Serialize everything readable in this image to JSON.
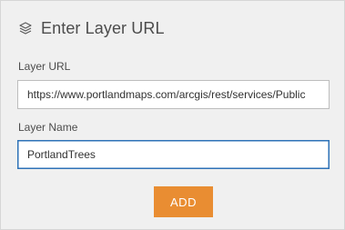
{
  "header": {
    "title": "Enter Layer URL",
    "icon": "layers-icon"
  },
  "form": {
    "url_label": "Layer URL",
    "url_value": "https://www.portlandmaps.com/arcgis/rest/services/Public",
    "name_label": "Layer Name",
    "name_value": "PortlandTrees"
  },
  "actions": {
    "add_label": "ADD"
  },
  "colors": {
    "accent": "#e98d32",
    "focus_border": "#2e72b7",
    "panel_bg": "#f0f0f0"
  }
}
